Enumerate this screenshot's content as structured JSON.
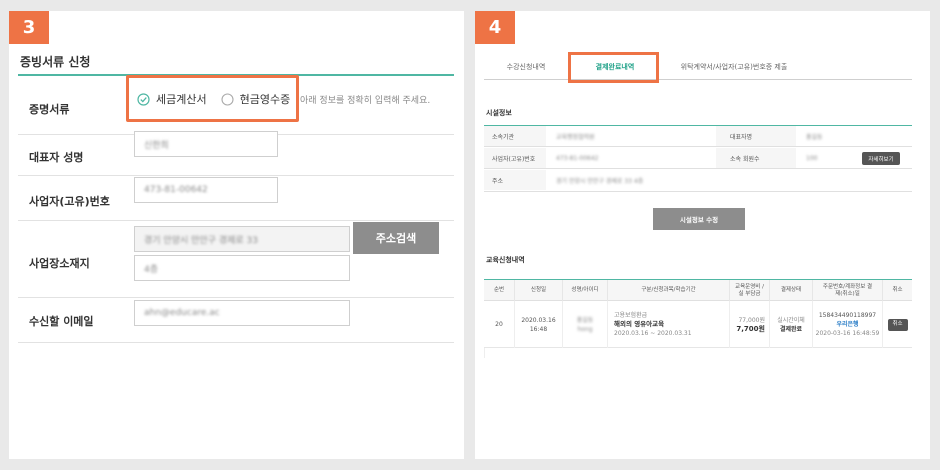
{
  "step3": {
    "badge": "3",
    "title": "증빙서류 신청",
    "fields": {
      "doc_type_label": "증명서류",
      "option_tax": "세금계산서",
      "option_cash": "현금영수증",
      "hint": "아래 정보를 정확히 입력해 주세요.",
      "rep_name_label": "대표자 성명",
      "rep_name_value": "신한희",
      "biz_no_label": "사업자(고유)번호",
      "biz_no_value": "473-81-00642",
      "address_label": "사업장소재지",
      "address_value": "경기 안양시 만안구 경제로 33",
      "address_detail_value": "4층",
      "address_search_btn": "주소검색",
      "email_label": "수신할 이메일",
      "email_value": "ahn@educare.ac"
    }
  },
  "step4": {
    "badge": "4",
    "tabs": [
      "수강신청내역",
      "결제완료내역",
      "위탁계약서/사업자(고유)번호증 제출"
    ],
    "facility": {
      "title": "시설정보",
      "org_label": "소속기관",
      "org_value": "교육행정협력원",
      "rep_label": "대표자명",
      "rep_value": "홍길동",
      "biz_label": "사업자(고유)번호",
      "biz_value": "473-81-00642",
      "members_label": "소속 회원수",
      "members_value": "100",
      "detail_btn": "자세히보기",
      "addr_label": "주소",
      "addr_value": "경기 안양시 만안구 경제로 33 4층",
      "edit_btn": "시설정보 수정"
    },
    "education": {
      "title": "교육신청내역",
      "headers": [
        "순번",
        "신청일",
        "성명/아이디",
        "구분/신청과목/학습기간",
        "교육운영비 / 실 부담금",
        "결제상태",
        "주문번호/계좌정보 결제(취소)일",
        "취소"
      ],
      "row": {
        "no": "20",
        "date": "2020.03.16",
        "time": "16:48",
        "name": "홍길동",
        "id": "hong",
        "category": "고용보험환급",
        "course": "해외의 영유아교육",
        "period": "2020.03.16 ~ 2020.03.31",
        "fee": "77,000원",
        "paid": "7,700원",
        "method": "실시간이체",
        "status": "결제완료",
        "order_no": "1584344901189​97",
        "bank": "우리은행",
        "pay_time": "2020-03-16 16:48:59",
        "cancel_btn": "취소"
      }
    }
  },
  "colors": {
    "accent": "#ee7345",
    "teal": "#4fb7a3",
    "active_tab": "#23a38a"
  }
}
